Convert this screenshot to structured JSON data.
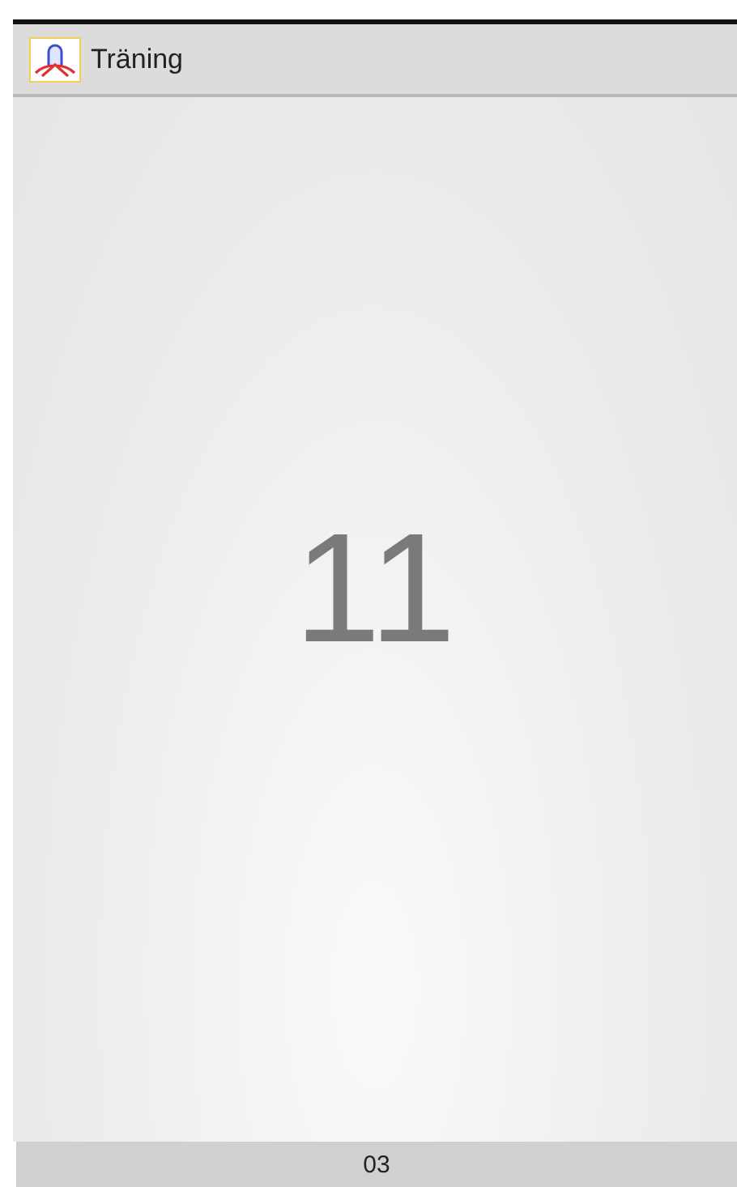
{
  "app_bar": {
    "title": "Träning"
  },
  "counter": {
    "value": "11"
  },
  "bottom_bar": {
    "text": "03"
  }
}
